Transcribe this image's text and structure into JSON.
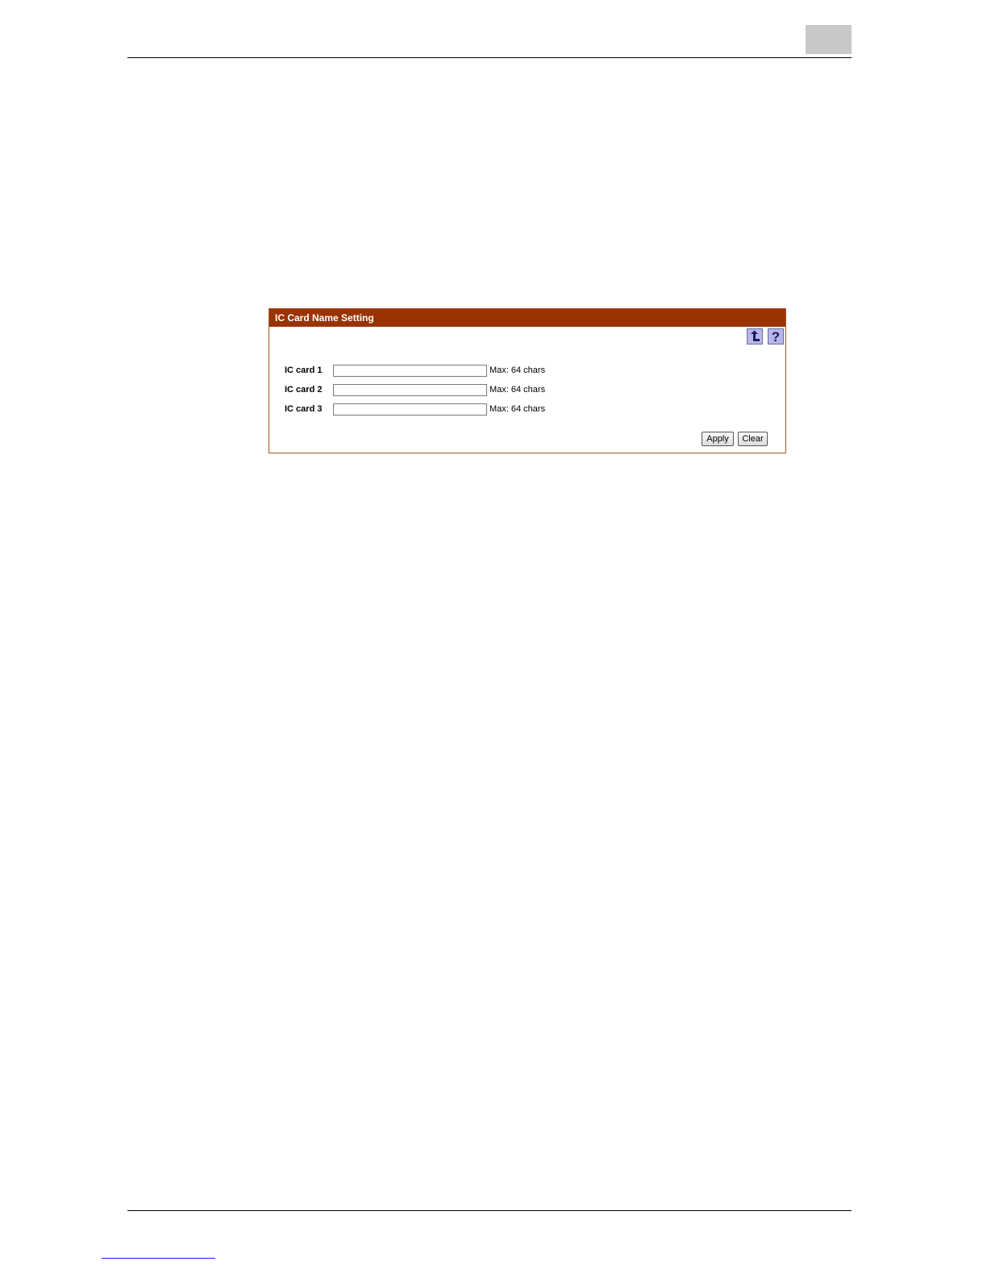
{
  "panel": {
    "title": "IC Card Name Setting",
    "icons": {
      "back": "back-arrow-icon",
      "help": "help-question-icon"
    },
    "fields": [
      {
        "label": "IC card 1",
        "value": "",
        "hint": "Max: 64 chars"
      },
      {
        "label": "IC card 2",
        "value": "",
        "hint": "Max: 64 chars"
      },
      {
        "label": "IC card 3",
        "value": "",
        "hint": "Max: 64 chars"
      }
    ],
    "buttons": {
      "apply": "Apply",
      "clear": "Clear"
    }
  },
  "colors": {
    "header_bg": "#993300",
    "panel_border": "#a55a2a",
    "icon_bg": "#b8b8e6"
  }
}
